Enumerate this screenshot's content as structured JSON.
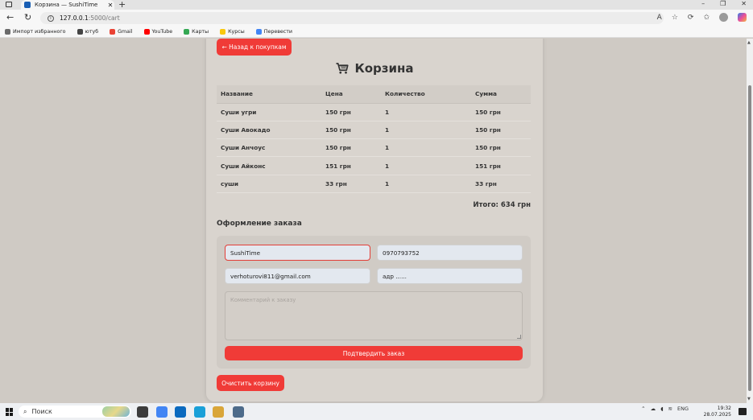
{
  "browser": {
    "tab_title": "Корзина — SushiTime",
    "tab_close": "✕",
    "new_tab": "+",
    "url_host": "127.0.0.1",
    "url_path": ":5000/cart",
    "win_min": "–",
    "win_max": "❐",
    "win_close": "✕",
    "bookmarks": [
      {
        "label": "Импорт избранного",
        "color": "#6b6b6b"
      },
      {
        "label": "ютуб",
        "color": "#444444"
      },
      {
        "label": "Gmail",
        "color": "#ea4335"
      },
      {
        "label": "YouTube",
        "color": "#ff0000"
      },
      {
        "label": "Карты",
        "color": "#34a853"
      },
      {
        "label": "Курсы",
        "color": "#f9c80e"
      },
      {
        "label": "Перевести",
        "color": "#4285f4"
      }
    ]
  },
  "page": {
    "back_button": "← Назад к покупкам",
    "cart_title": "Корзина",
    "columns": [
      "Название",
      "Цена",
      "Количество",
      "Сумма"
    ],
    "rows": [
      [
        "Суши угри",
        "150 грн",
        "1",
        "150 грн"
      ],
      [
        "Суши Авокадо",
        "150 грн",
        "1",
        "150 грн"
      ],
      [
        "Суши Анчоус",
        "150 грн",
        "1",
        "150 грн"
      ],
      [
        "Суши Айконс",
        "151 грн",
        "1",
        "151 грн"
      ],
      [
        "суши",
        "33 грн",
        "1",
        "33 грн"
      ]
    ],
    "total": "Итого: 634 грн",
    "order_heading": "Оформление заказа",
    "form": {
      "name_value": "SushiTime",
      "phone_value": "0970793752",
      "email_value": "verhoturovi811@gmail.com",
      "address_value": "адр ......",
      "comment_placeholder": "Комментарий к заказу",
      "submit_label": "Подтвердить заказ"
    },
    "clear_button": "Очистить корзину"
  },
  "taskbar": {
    "search_label": "Поиск",
    "lang": "ENG",
    "time": "19:32",
    "date": "28.07.2025",
    "app_colors": [
      "#3c3c3c",
      "#4285f4",
      "#0b6abf",
      "#1aa0d8",
      "#d9a63a",
      "#4d6b8a"
    ]
  }
}
